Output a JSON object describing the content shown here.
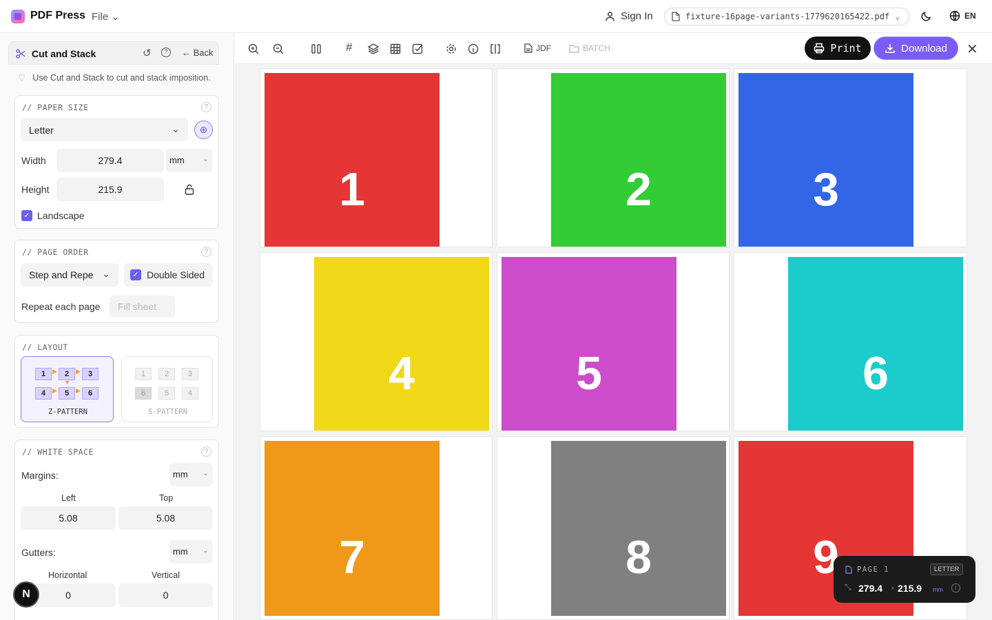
{
  "app": {
    "brand": "PDF Press",
    "file_menu": "File",
    "sign_in": "Sign In",
    "file_name": "fixture-16page-variants-1779620165422.pdf",
    "lang": "EN"
  },
  "panel": {
    "title": "Cut and Stack",
    "back": "Back",
    "tip": "Use Cut and Stack to cut and stack imposition.",
    "paper_size": {
      "title": "// PAPER SIZE",
      "preset": "Letter",
      "width_label": "Width",
      "width": "279.4",
      "height_label": "Height",
      "height": "215.9",
      "unit": "mm",
      "landscape_label": "Landscape",
      "landscape": true
    },
    "page_order": {
      "title": "// PAGE ORDER",
      "mode": "Step and Repe",
      "double_sided_label": "Double Sided",
      "double_sided": true,
      "repeat_label": "Repeat each page",
      "repeat_placeholder": "Fill sheet"
    },
    "layout": {
      "title": "// LAYOUT",
      "options": [
        {
          "label": "Z-PATTERN",
          "selected": true,
          "cells": [
            "1",
            "2",
            "3",
            "4",
            "5",
            "6"
          ]
        },
        {
          "label": "S-PATTERN",
          "selected": false,
          "cells": [
            "1",
            "2",
            "3",
            "6",
            "5",
            "4"
          ]
        }
      ]
    },
    "white_space": {
      "title": "// WHITE SPACE",
      "margins_label": "Margins:",
      "margins_unit": "mm",
      "left_label": "Left",
      "left": "5.08",
      "top_label": "Top",
      "top": "5.08",
      "gutters_label": "Gutters:",
      "gutters_unit": "mm",
      "horizontal_label": "Horizontal",
      "horizontal": "0",
      "vertical_label": "Vertical",
      "vertical": "0"
    }
  },
  "toolbar": {
    "jdf": "JDF",
    "batch": "BATCH",
    "print": "Print",
    "download": "Download"
  },
  "pages": [
    {
      "num": "1",
      "color": "#e53535"
    },
    {
      "num": "2",
      "color": "#34cc34"
    },
    {
      "num": "3",
      "color": "#3366e6"
    },
    {
      "num": "4",
      "color": "#f0d818"
    },
    {
      "num": "5",
      "color": "#cc4ccc"
    },
    {
      "num": "6",
      "color": "#1ccccc"
    },
    {
      "num": "7",
      "color": "#f09818"
    },
    {
      "num": "8",
      "color": "#808080"
    },
    {
      "num": "9",
      "color": "#e53535"
    }
  ],
  "page_info": {
    "label": "PAGE 1",
    "size_badge": "LETTER",
    "width": "279.4",
    "height": "215.9",
    "unit": "mm"
  },
  "avatar": "N",
  "colors": {
    "accent": "#7c5cf6",
    "dark": "#121212"
  }
}
